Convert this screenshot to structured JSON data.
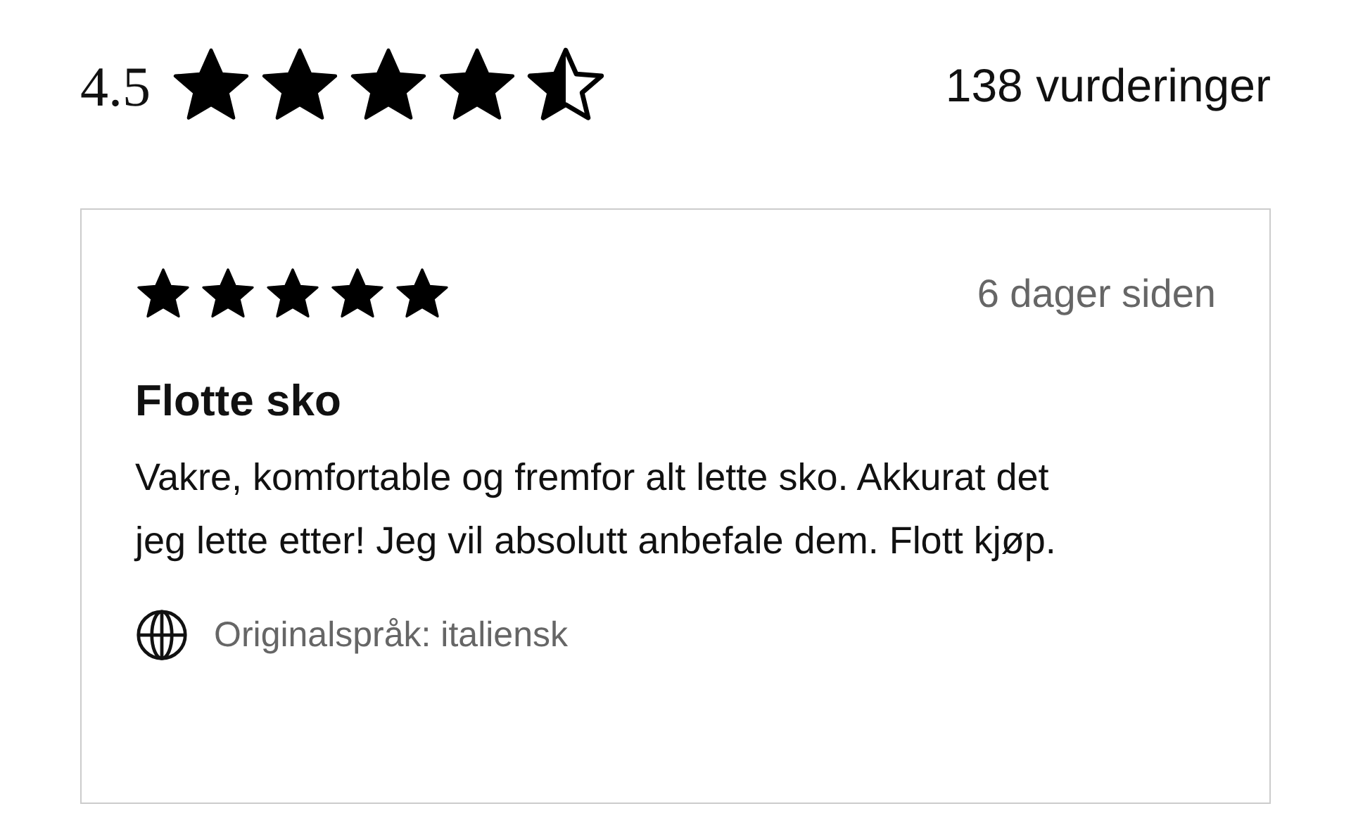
{
  "summary": {
    "average": "4.5",
    "stars": 4.5,
    "count": "138 vurderinger"
  },
  "review": {
    "stars": 5,
    "date": "6 dager siden",
    "title": "Flotte sko",
    "body": "Vakre, komfortable og fremfor alt lette sko. Akkurat det jeg lette etter! Jeg vil absolutt anbefale dem. Flott kjøp.",
    "language": "Originalspråk: italiensk"
  }
}
